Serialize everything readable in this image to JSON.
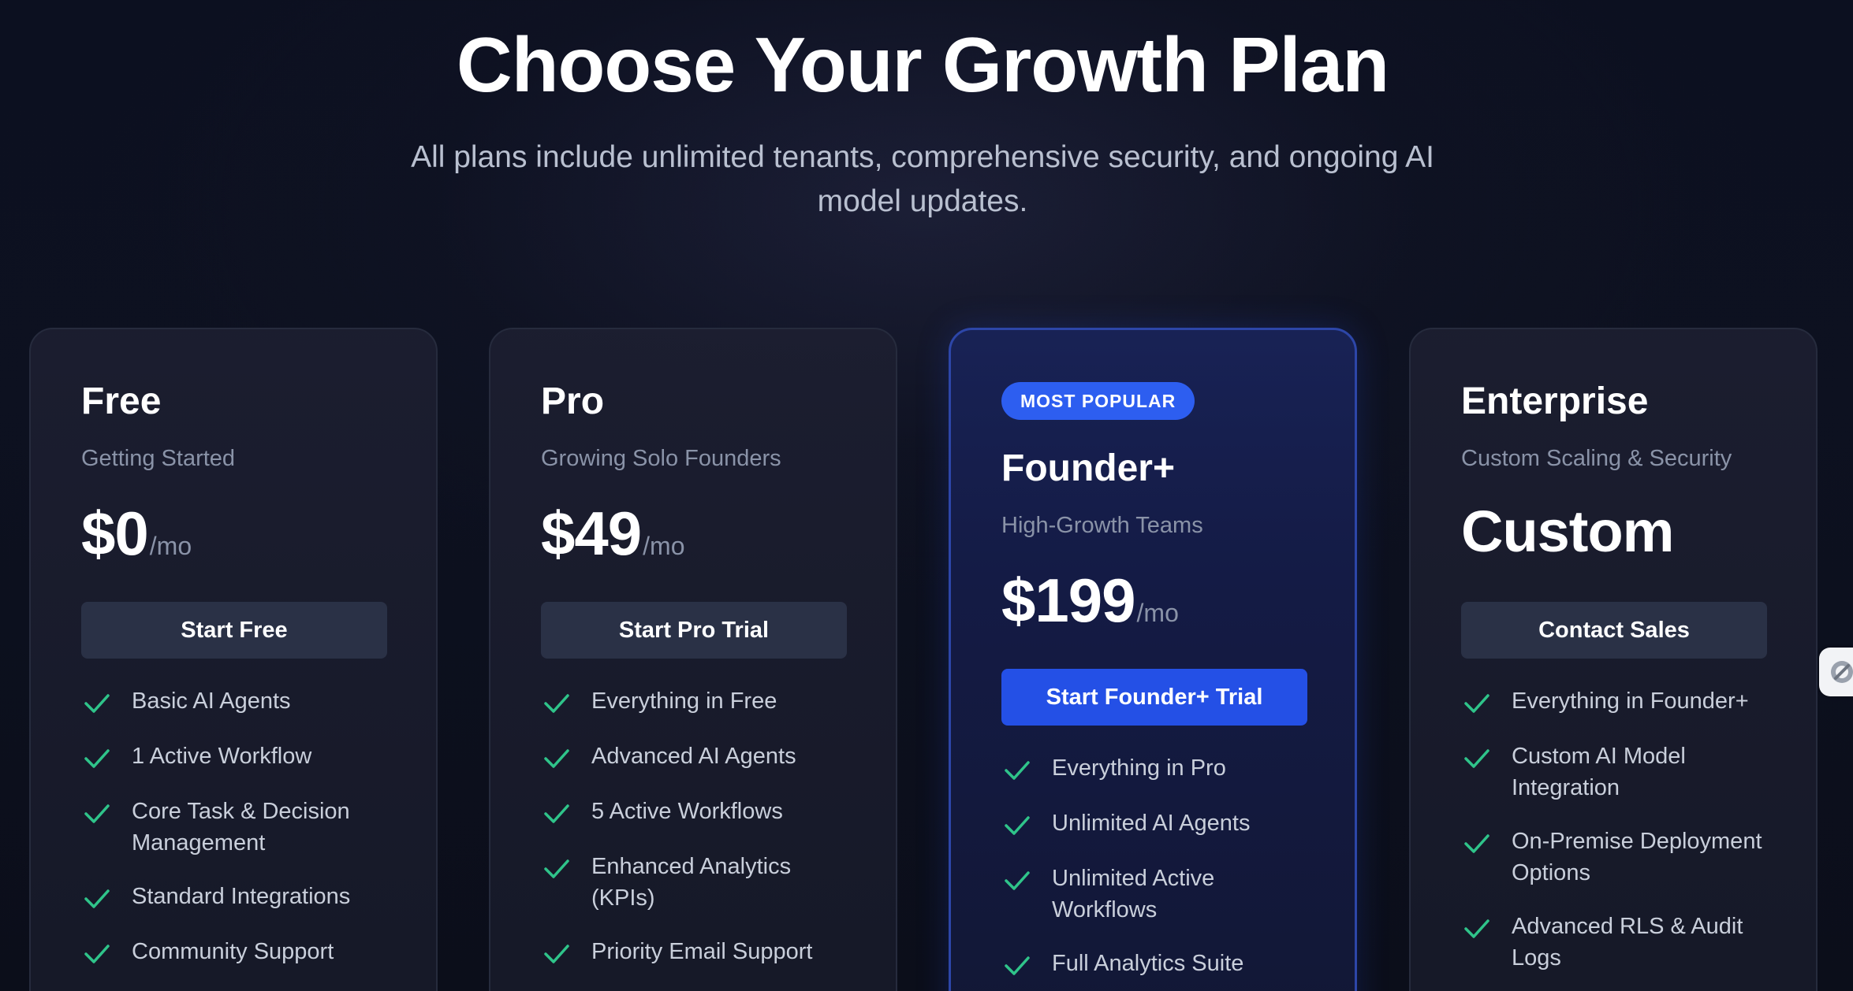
{
  "header": {
    "title": "Choose Your Growth Plan",
    "subtitle": "All plans include unlimited tenants, comprehensive security, and ongoing AI model updates."
  },
  "colors": {
    "accent": "#2450e6",
    "check": "#2fc48a",
    "background": "#0c1020"
  },
  "plans": [
    {
      "name": "Free",
      "tagline": "Getting Started",
      "price": "$0",
      "period": "/mo",
      "cta": "Start Free",
      "features": [
        "Basic AI Agents",
        "1 Active Workflow",
        "Core Task & Decision Management",
        "Standard Integrations",
        "Community Support"
      ]
    },
    {
      "name": "Pro",
      "tagline": "Growing Solo Founders",
      "price": "$49",
      "period": "/mo",
      "cta": "Start Pro Trial",
      "features": [
        "Everything in Free",
        "Advanced AI Agents",
        "5 Active Workflows",
        "Enhanced Analytics (KPIs)",
        "Priority Email Support"
      ]
    },
    {
      "badge": "MOST POPULAR",
      "name": "Founder+",
      "tagline": "High-Growth Teams",
      "price": "$199",
      "period": "/mo",
      "cta": "Start Founder+ Trial",
      "features": [
        "Everything in Pro",
        "Unlimited AI Agents",
        "Unlimited Active Workflows",
        "Full Analytics Suite"
      ]
    },
    {
      "name": "Enterprise",
      "tagline": "Custom Scaling & Security",
      "price": "Custom",
      "cta": "Contact Sales",
      "features": [
        "Everything in Founder+",
        "Custom AI Model Integration",
        "On-Premise Deployment Options",
        "Advanced RLS & Audit Logs"
      ]
    }
  ],
  "icons": {
    "feature_check": "check-icon",
    "side_widget": "assistant-widget-icon"
  }
}
